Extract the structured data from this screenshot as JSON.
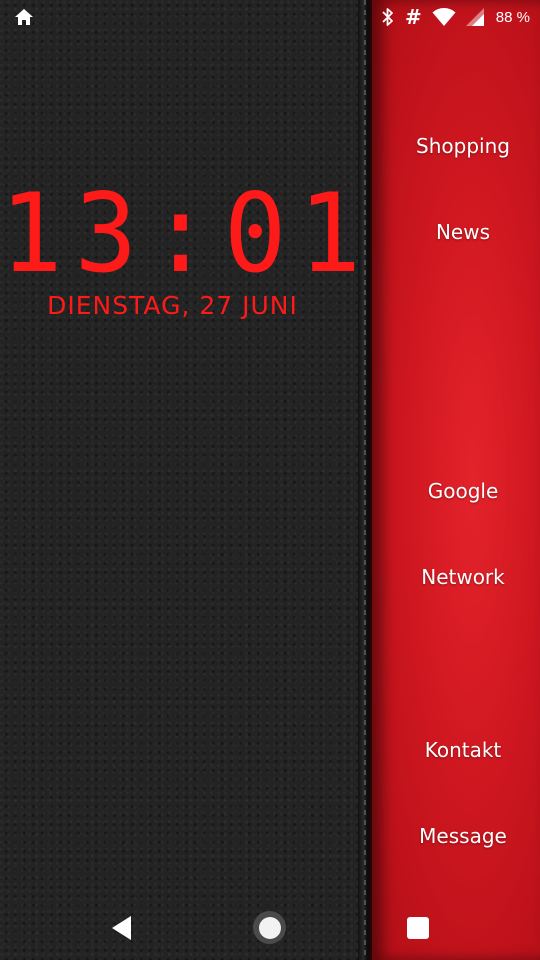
{
  "status_bar": {
    "left_icon": "home-icon",
    "icons": [
      "bluetooth-icon",
      "hash-icon",
      "wifi-icon",
      "cell-signal-icon"
    ],
    "hash_glyph": "#",
    "battery": "88 %"
  },
  "clock_widget": {
    "time": "13:01",
    "date": "DIENSTAG, 27 JUNI",
    "color": "#ff1a1a"
  },
  "side_panel": {
    "color": "#d11a22",
    "items": [
      {
        "label": "Shopping"
      },
      {
        "label": "News"
      },
      {
        "label": "Google"
      },
      {
        "label": "Network"
      },
      {
        "label": "Kontakt"
      },
      {
        "label": "Message"
      }
    ]
  },
  "nav_bar": {
    "buttons": [
      "back-icon",
      "home-circle-icon",
      "recents-square-icon"
    ]
  }
}
